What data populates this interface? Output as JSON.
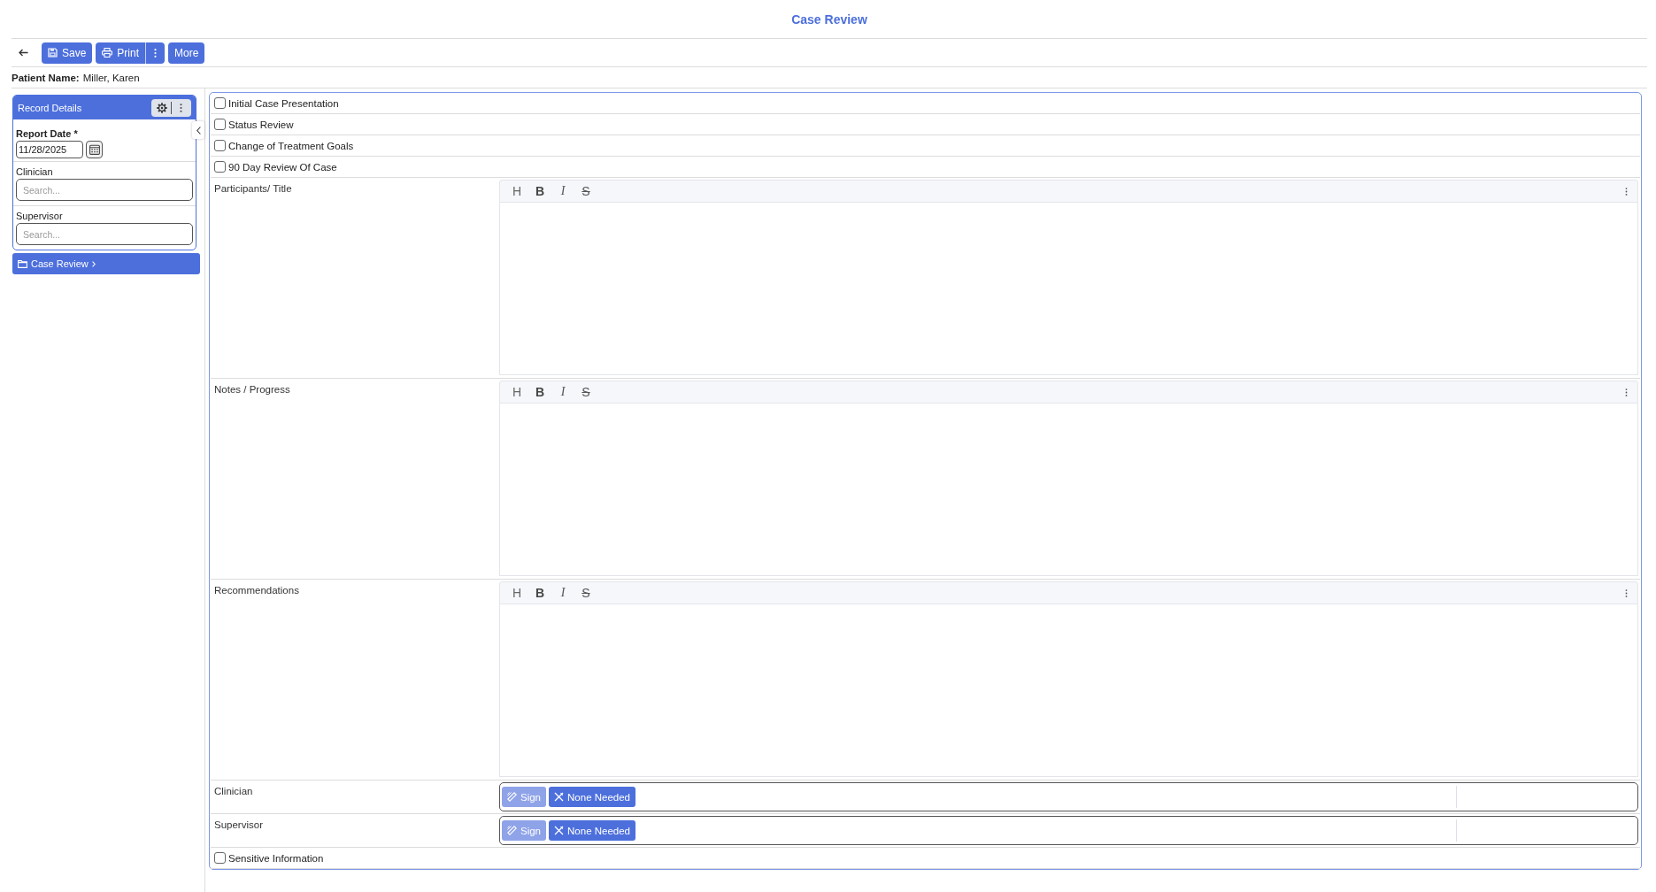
{
  "header": {
    "title": "Case Review"
  },
  "toolbar": {
    "save": {
      "label": "Save"
    },
    "print": {
      "label": "Print"
    },
    "more": {
      "label": "More"
    }
  },
  "patient": {
    "label": "Patient Name:",
    "value": "Miller, Karen"
  },
  "sidebar": {
    "title": "Record Details",
    "fields": [
      {
        "kind": "date",
        "label": "Report Date *",
        "value": "11/28/2025"
      },
      {
        "kind": "search",
        "label": "Clinician",
        "placeholder": "Search..."
      },
      {
        "kind": "search",
        "label": "Supervisor",
        "placeholder": "Search..."
      }
    ],
    "nav": [
      {
        "label": "Case Review",
        "selected": true
      }
    ]
  },
  "form": {
    "checkboxes": [
      {
        "label": "Initial Case Presentation",
        "checked": false
      },
      {
        "label": "Status Review",
        "checked": false
      },
      {
        "label": "Change of Treatment Goals",
        "checked": false
      },
      {
        "label": "90 Day Review Of Case",
        "checked": false
      }
    ],
    "sections": [
      {
        "kind": "editor",
        "label": "Participants/ Title",
        "tools": [
          {
            "label": "H",
            "kind": "heading"
          },
          {
            "label": "B",
            "kind": "bold"
          },
          {
            "label": "I",
            "kind": "italic"
          },
          {
            "label": "S",
            "kind": "strike"
          }
        ]
      },
      {
        "kind": "editor",
        "label": "Notes / Progress",
        "tools": [
          {
            "label": "H",
            "kind": "heading"
          },
          {
            "label": "B",
            "kind": "bold"
          },
          {
            "label": "I",
            "kind": "italic"
          },
          {
            "label": "S",
            "kind": "strike"
          }
        ]
      },
      {
        "kind": "editor",
        "label": "Recommendations",
        "tools": [
          {
            "label": "H",
            "kind": "heading"
          },
          {
            "label": "B",
            "kind": "bold"
          },
          {
            "label": "I",
            "kind": "italic"
          },
          {
            "label": "S",
            "kind": "strike"
          }
        ]
      },
      {
        "kind": "signature",
        "label": "Clinician",
        "buttons": [
          {
            "kind": "sign",
            "label": "Sign",
            "disabled": true
          },
          {
            "kind": "none",
            "label": "None Needed",
            "disabled": false
          }
        ]
      },
      {
        "kind": "signature",
        "label": "Supervisor",
        "buttons": [
          {
            "kind": "sign",
            "label": "Sign",
            "disabled": true
          },
          {
            "kind": "none",
            "label": "None Needed",
            "disabled": false
          }
        ]
      }
    ],
    "sensitive": {
      "label": "Sensitive Information",
      "checked": false
    }
  }
}
